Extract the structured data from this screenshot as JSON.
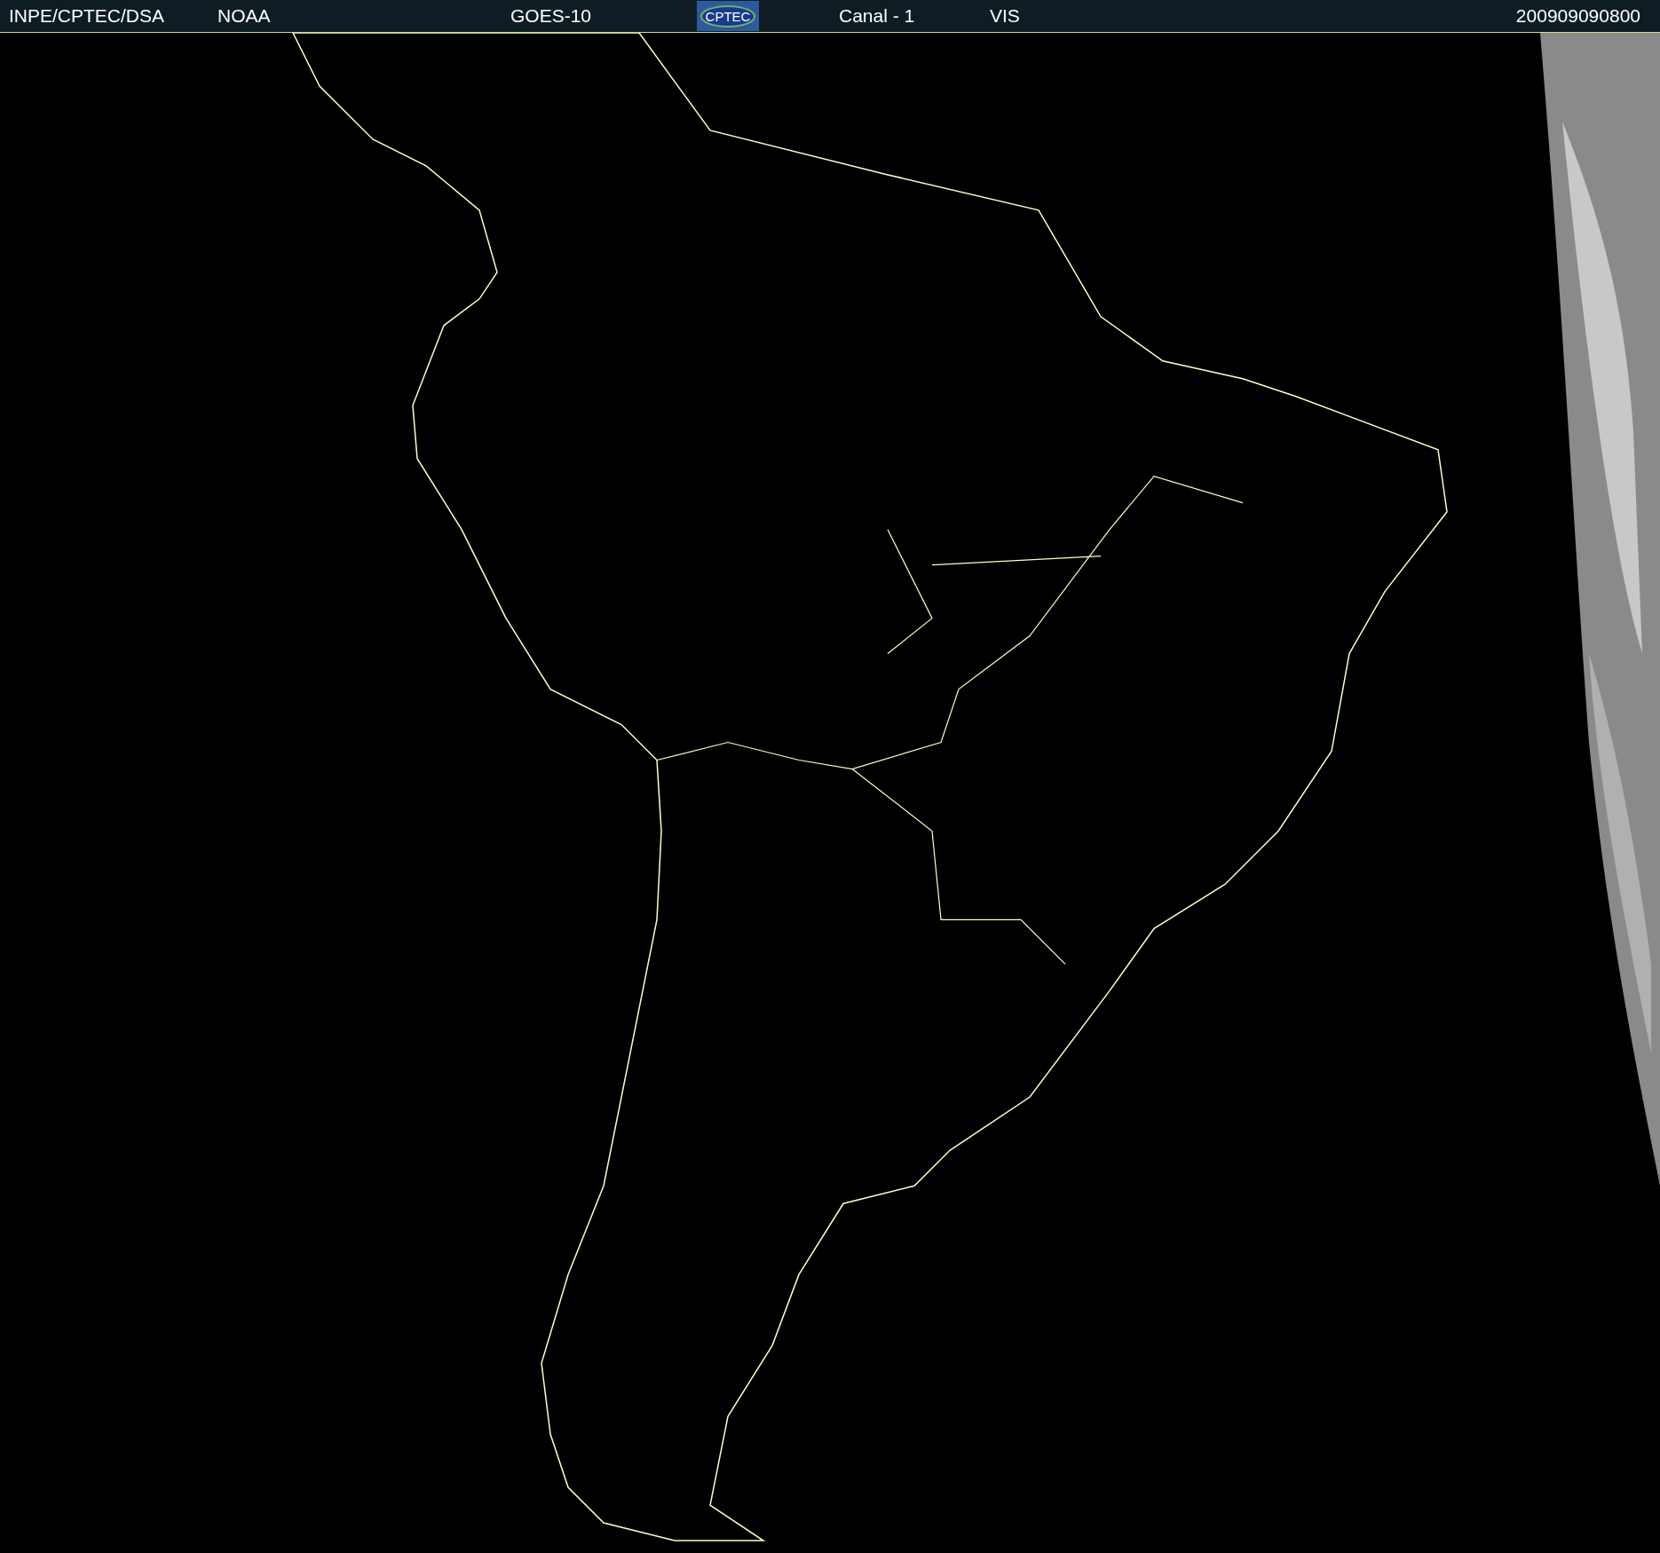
{
  "header": {
    "items": [
      {
        "kind": "text",
        "text": "INPE/CPTEC/DSA"
      },
      {
        "kind": "text",
        "text": "NOAA"
      },
      {
        "kind": "text",
        "text": "GOES-10"
      },
      {
        "kind": "logo",
        "text": "CPTEC"
      },
      {
        "kind": "text",
        "text": "Canal - 1"
      },
      {
        "kind": "text",
        "text": "VIS"
      },
      {
        "kind": "text",
        "text": "200909090800"
      }
    ]
  }
}
